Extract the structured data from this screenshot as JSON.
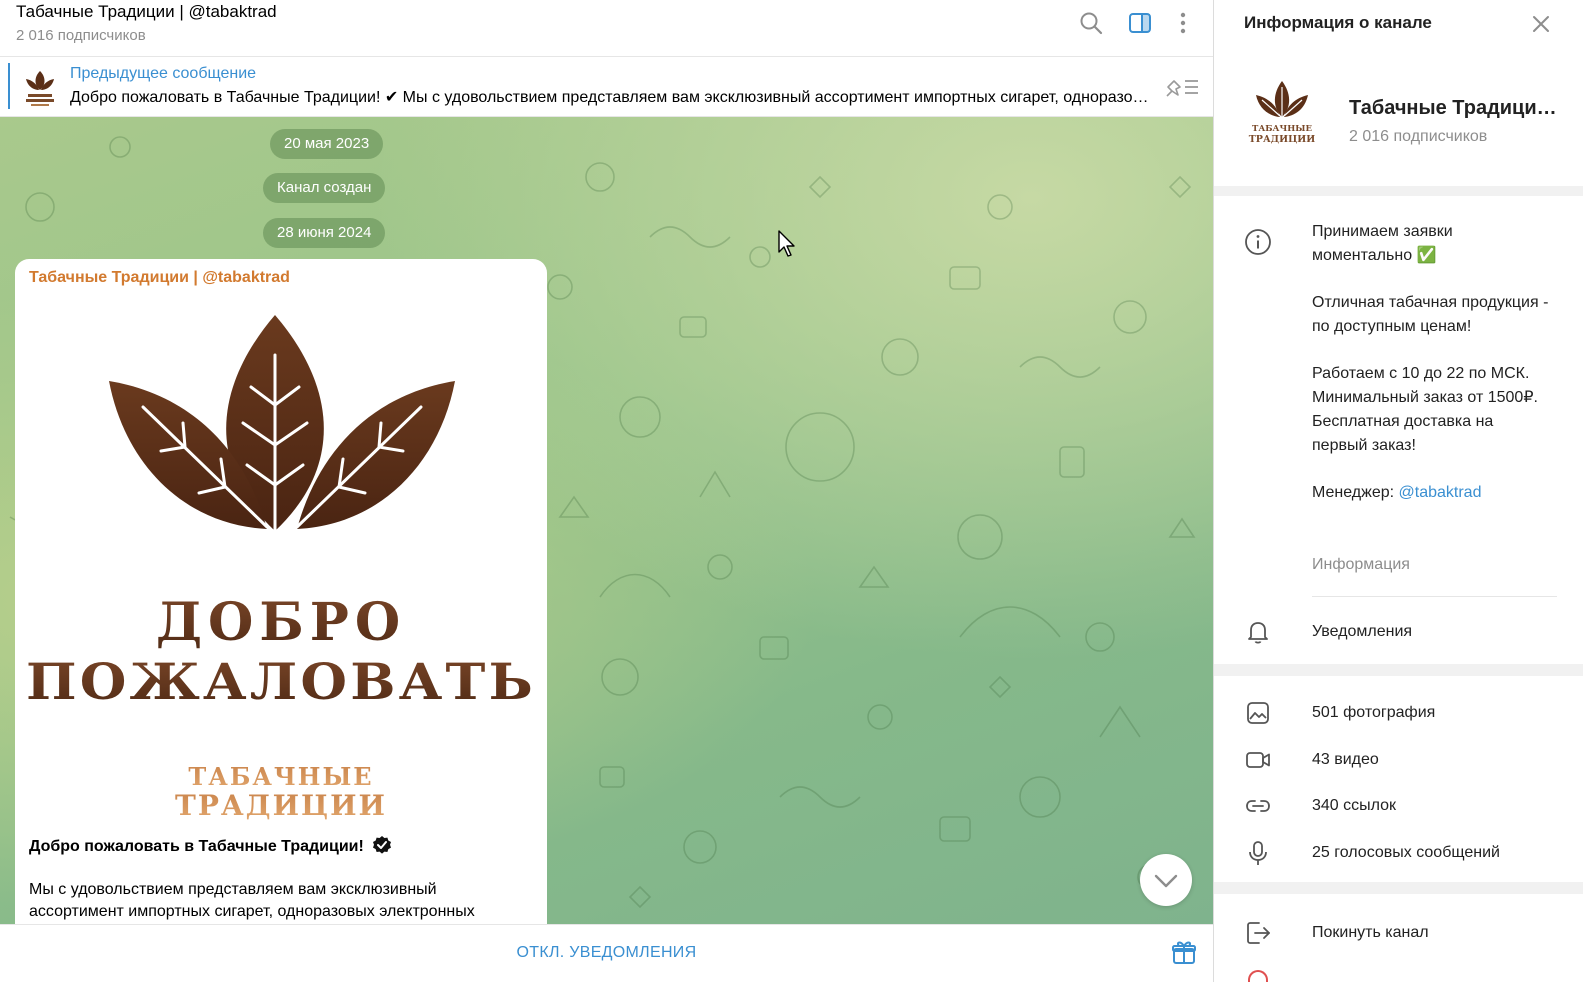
{
  "colors": {
    "accent": "#3a8fd1",
    "author": "#d27a2f",
    "brown": "#5b2f17"
  },
  "header": {
    "title": "Табачные Традиции | @tabaktrad",
    "subscribers": "2 016 подписчиков",
    "icons": [
      "search-icon",
      "sidebar-toggle-icon",
      "more-vertical-icon"
    ]
  },
  "pinned": {
    "label": "Предыдущее сообщение",
    "text": "Добро пожаловать в Табачные Традиции! ✔ Мы с удовольствием представляем вам эксклюзивный ассортимент импортных сигарет, одноразовых электронных..."
  },
  "timeline": {
    "date1": "20 мая 2023",
    "service": "Канал создан",
    "date2": "28 июня 2024"
  },
  "post": {
    "author": "Табачные Традиции | @tabaktrad",
    "image_text": {
      "line1": "ДОБРО",
      "line2": "ПОЖАЛОВАТЬ",
      "brand1": "ТАБАЧНЫЕ",
      "brand2": "ТРАДИЦИИ"
    },
    "title": "Добро пожаловать в Табачные Традиции!",
    "body": "Мы с удовольствием представляем вам эксклюзивный ассортимент импортных сигарет, одноразовых электронных"
  },
  "bottom": {
    "mute_label": "ОТКЛ. УВЕДОМЛЕНИЯ"
  },
  "info": {
    "title": "Информация о канале",
    "name": "Табачные Традиции | @tabaktrad",
    "subscribers": "2 016 подписчиков",
    "avatar_text": {
      "line1": "ТАБАЧНЫЕ",
      "line2": "ТРАДИЦИИ"
    },
    "about": {
      "p1": "Принимаем заявки моментально ✅",
      "p2": "Отличная табачная продукция - по доступным ценам!",
      "p3a": "Работаем с 10 до 22 по МСК.",
      "p3b": "Минимальный заказ от 1500₽.",
      "p3c": "Бесплатная доставка на первый заказ!",
      "manager_label": "Менеджер: ",
      "manager_link": "@tabaktrad"
    },
    "about_caption": "Информация",
    "notifications_label": "Уведомления",
    "notifications_on": true,
    "media": [
      {
        "label": "501 фотография",
        "icon": "photo-icon"
      },
      {
        "label": "43 видео",
        "icon": "video-icon"
      },
      {
        "label": "340 ссылок",
        "icon": "link-icon"
      },
      {
        "label": "25 голосовых сообщений",
        "icon": "microphone-icon"
      }
    ],
    "leave_label": "Покинуть канал"
  }
}
